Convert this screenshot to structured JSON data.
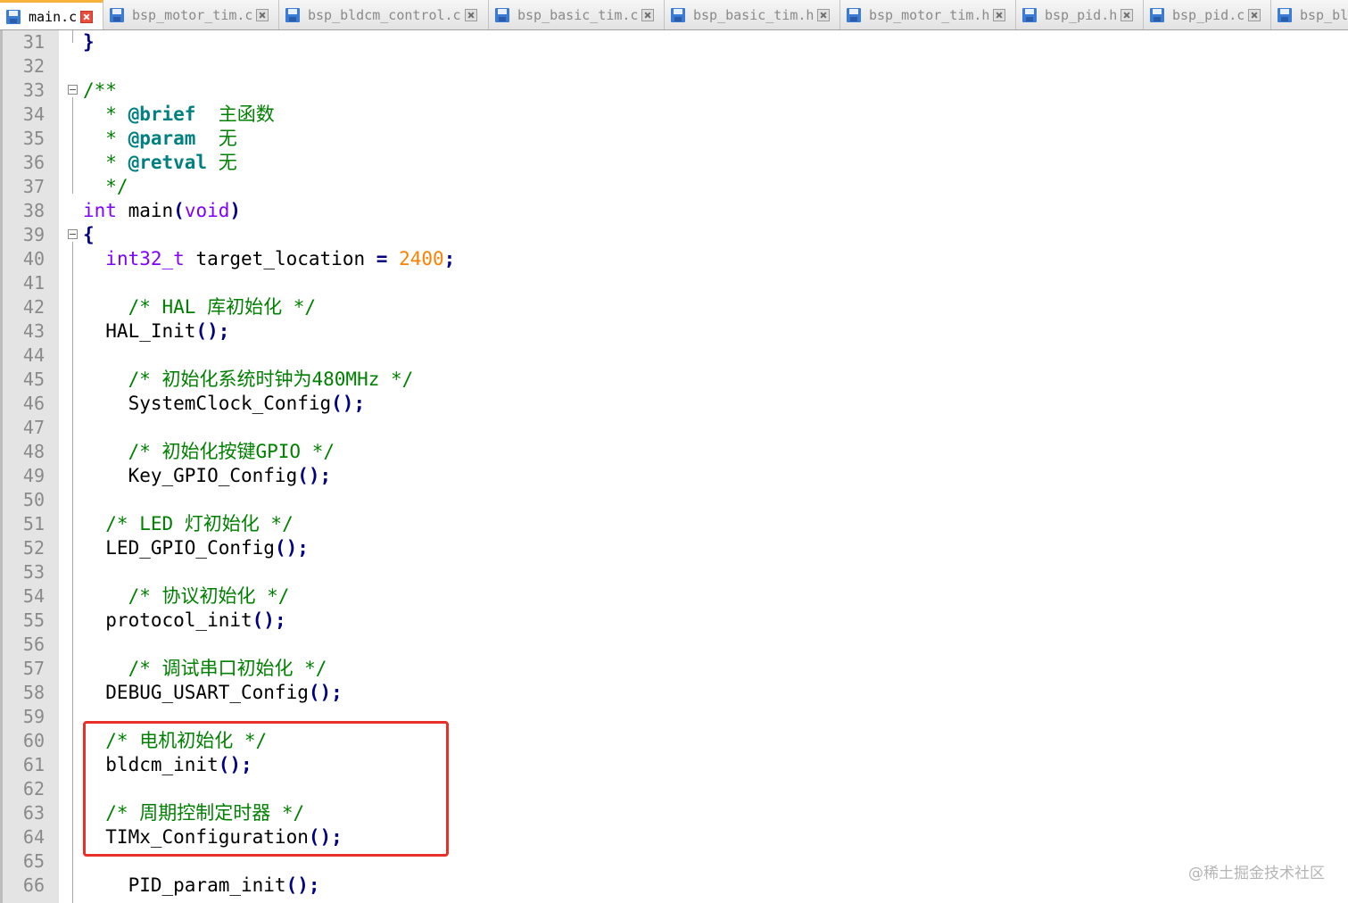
{
  "tabs": [
    {
      "label": "main.c",
      "active": true
    },
    {
      "label": "bsp_motor_tim.c",
      "active": false
    },
    {
      "label": "bsp_bldcm_control.c",
      "active": false
    },
    {
      "label": "bsp_basic_tim.c",
      "active": false
    },
    {
      "label": "bsp_basic_tim.h",
      "active": false
    },
    {
      "label": "bsp_motor_tim.h",
      "active": false
    },
    {
      "label": "bsp_pid.h",
      "active": false
    },
    {
      "label": "bsp_pid.c",
      "active": false
    },
    {
      "label": "bsp_bl",
      "active": false
    }
  ],
  "lines": [
    {
      "n": "31",
      "tokens": [
        [
          "br",
          "}"
        ]
      ]
    },
    {
      "n": "32",
      "tokens": []
    },
    {
      "n": "33",
      "tokens": [
        [
          "cm",
          "/**"
        ]
      ]
    },
    {
      "n": "34",
      "tokens": [
        [
          "cm",
          "  * "
        ],
        [
          "dk",
          "@brief"
        ],
        [
          "cm",
          "  主函数"
        ]
      ]
    },
    {
      "n": "35",
      "tokens": [
        [
          "cm",
          "  * "
        ],
        [
          "dk",
          "@param"
        ],
        [
          "cm",
          "  无"
        ]
      ]
    },
    {
      "n": "36",
      "tokens": [
        [
          "cm",
          "  * "
        ],
        [
          "dk",
          "@retval"
        ],
        [
          "cm",
          " 无"
        ]
      ]
    },
    {
      "n": "37",
      "tokens": [
        [
          "cm",
          "  */"
        ]
      ]
    },
    {
      "n": "38",
      "tokens": [
        [
          "kw",
          "int"
        ],
        [
          "",
          " main"
        ],
        [
          "op",
          "("
        ],
        [
          "kw",
          "void"
        ],
        [
          "op",
          ")"
        ]
      ]
    },
    {
      "n": "39",
      "tokens": [
        [
          "br",
          "{"
        ]
      ]
    },
    {
      "n": "40",
      "tokens": [
        [
          "",
          "  "
        ],
        [
          "kw",
          "int32_t"
        ],
        [
          "",
          " target_location "
        ],
        [
          "op",
          "="
        ],
        [
          "",
          " "
        ],
        [
          "num",
          "2400"
        ],
        [
          "op",
          ";"
        ]
      ]
    },
    {
      "n": "41",
      "tokens": []
    },
    {
      "n": "42",
      "tokens": [
        [
          "cm",
          "    /* HAL 库初始化 */"
        ]
      ]
    },
    {
      "n": "43",
      "tokens": [
        [
          "",
          "  HAL_Init"
        ],
        [
          "op",
          "();"
        ]
      ]
    },
    {
      "n": "44",
      "tokens": []
    },
    {
      "n": "45",
      "tokens": [
        [
          "cm",
          "    /* 初始化系统时钟为480MHz */"
        ]
      ]
    },
    {
      "n": "46",
      "tokens": [
        [
          "",
          "    SystemClock_Config"
        ],
        [
          "op",
          "();"
        ]
      ]
    },
    {
      "n": "47",
      "tokens": []
    },
    {
      "n": "48",
      "tokens": [
        [
          "cm",
          "    /* 初始化按键GPIO */"
        ]
      ]
    },
    {
      "n": "49",
      "tokens": [
        [
          "",
          "    Key_GPIO_Config"
        ],
        [
          "op",
          "();"
        ]
      ]
    },
    {
      "n": "50",
      "tokens": []
    },
    {
      "n": "51",
      "tokens": [
        [
          "cm",
          "  /* LED 灯初始化 */"
        ]
      ]
    },
    {
      "n": "52",
      "tokens": [
        [
          "",
          "  LED_GPIO_Config"
        ],
        [
          "op",
          "();"
        ]
      ]
    },
    {
      "n": "53",
      "tokens": []
    },
    {
      "n": "54",
      "tokens": [
        [
          "cm",
          "    /* 协议初始化 */"
        ]
      ]
    },
    {
      "n": "55",
      "tokens": [
        [
          "",
          "  protocol_init"
        ],
        [
          "op",
          "();"
        ]
      ]
    },
    {
      "n": "56",
      "tokens": []
    },
    {
      "n": "57",
      "tokens": [
        [
          "cm",
          "    /* 调试串口初始化 */"
        ]
      ]
    },
    {
      "n": "58",
      "tokens": [
        [
          "",
          "  DEBUG_USART_Config"
        ],
        [
          "op",
          "();"
        ]
      ]
    },
    {
      "n": "59",
      "tokens": []
    },
    {
      "n": "60",
      "tokens": [
        [
          "cm",
          "  /* 电机初始化 */"
        ]
      ]
    },
    {
      "n": "61",
      "tokens": [
        [
          "",
          "  bldcm_init"
        ],
        [
          "op",
          "();"
        ]
      ]
    },
    {
      "n": "62",
      "tokens": []
    },
    {
      "n": "63",
      "tokens": [
        [
          "cm",
          "  /* 周期控制定时器 */"
        ]
      ]
    },
    {
      "n": "64",
      "tokens": [
        [
          "",
          "  TIMx_Configuration"
        ],
        [
          "op",
          "();"
        ]
      ]
    },
    {
      "n": "65",
      "tokens": []
    },
    {
      "n": "66",
      "tokens": [
        [
          "",
          "    PID_param_init"
        ],
        [
          "op",
          "();"
        ]
      ]
    }
  ],
  "watermark": "@稀土掘金技术社区",
  "colors": {
    "highlight_box": "#e8302a",
    "keyword": "#8000ff",
    "comment": "#008000",
    "number": "#ff8000"
  }
}
